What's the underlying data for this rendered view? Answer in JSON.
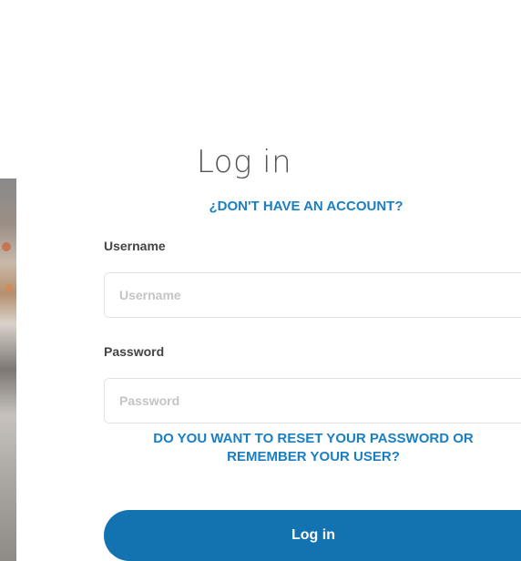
{
  "form": {
    "title": "Log in",
    "signup_link": "¿DON'T HAVE AN ACCOUNT?",
    "username": {
      "label": "Username",
      "placeholder": "Username",
      "value": ""
    },
    "password": {
      "label": "Password",
      "placeholder": "Password",
      "value": ""
    },
    "reset_link": {
      "line1": "DO YOU WANT TO RESET YOUR PASSWORD OR",
      "line2": "REMEMBER YOUR USER?"
    },
    "submit_label": "Log in"
  },
  "colors": {
    "accent": "#1a7fc2",
    "button": "#1273b0",
    "title": "#555555",
    "label": "#444444",
    "placeholder": "#c4c4c4",
    "input_border": "#e3e3e3"
  }
}
